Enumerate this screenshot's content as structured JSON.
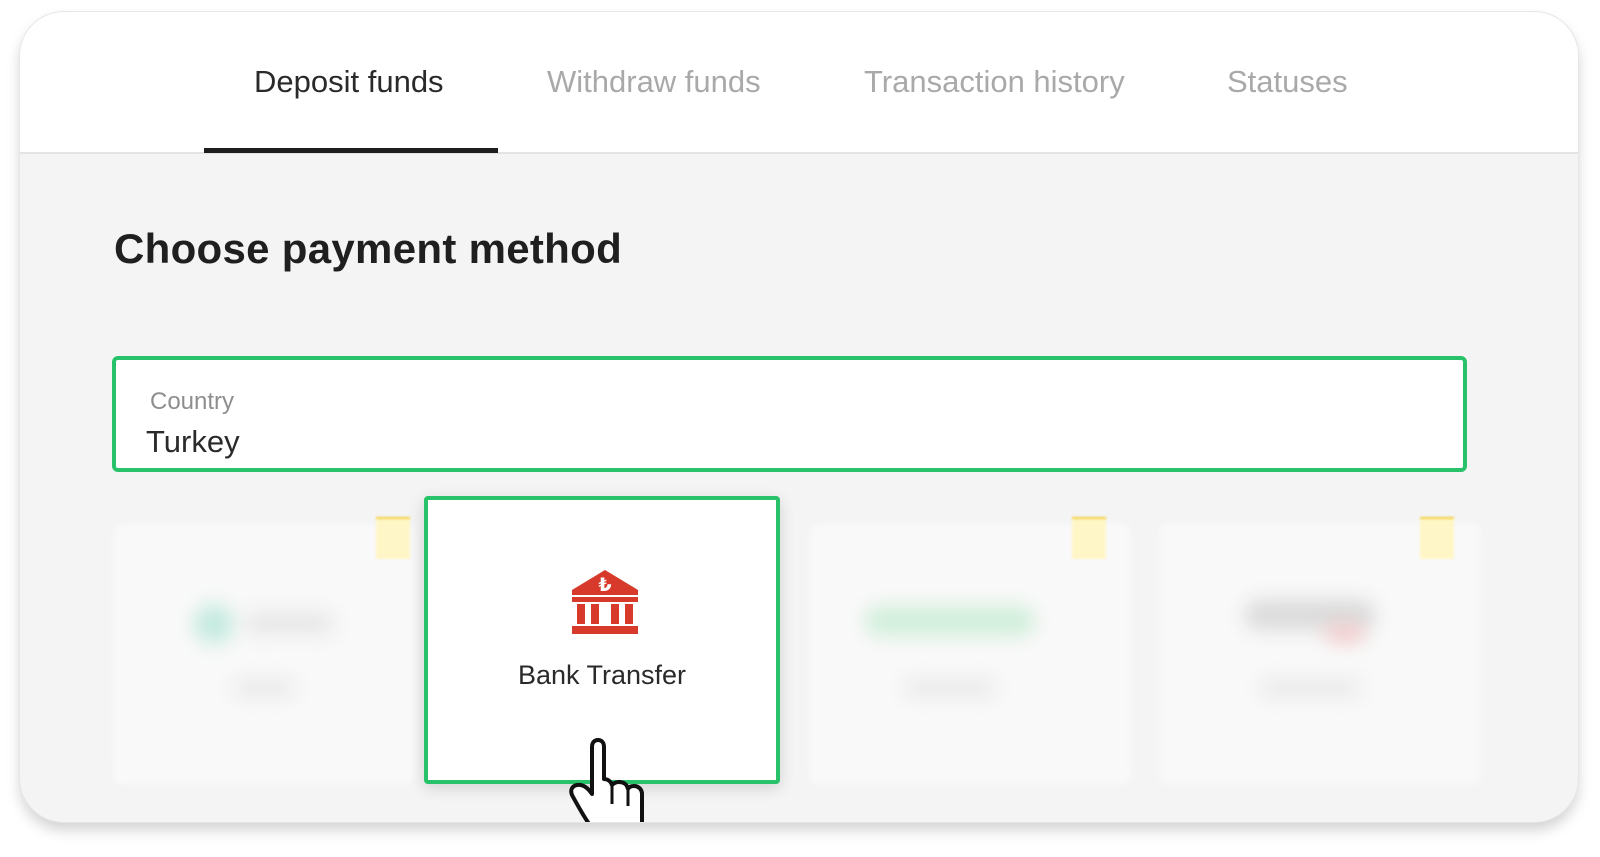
{
  "tabs": [
    {
      "label": "Deposit funds",
      "active": true
    },
    {
      "label": "Withdraw funds",
      "active": false
    },
    {
      "label": "Transaction history",
      "active": false
    },
    {
      "label": "Statuses",
      "active": false
    }
  ],
  "page": {
    "title": "Choose payment method"
  },
  "country": {
    "label": "Country",
    "value": "Turkey"
  },
  "methods": [
    {
      "label": "Bank Transfer",
      "icon": "bank-lira-icon",
      "selected": true
    }
  ],
  "colors": {
    "accent_green": "#27c26a",
    "bank_icon_red": "#d7392b",
    "tag_yellow": "#f2cf3d"
  },
  "cursor": {
    "icon": "hand-pointer-icon"
  }
}
